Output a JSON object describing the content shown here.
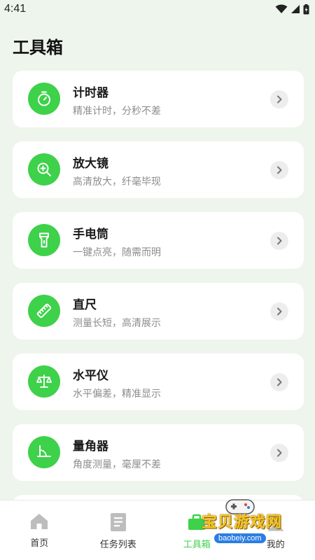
{
  "status_bar": {
    "time": "4:41",
    "icons": [
      "wifi-icon",
      "signal-icon",
      "battery-icon"
    ]
  },
  "page": {
    "title": "工具箱"
  },
  "tools": [
    {
      "name": "计时器",
      "desc": "精准计时，分秒不差",
      "icon": "stopwatch-icon"
    },
    {
      "name": "放大镜",
      "desc": "高清放大，纤毫毕现",
      "icon": "magnifier-icon"
    },
    {
      "name": "手电筒",
      "desc": "一键点亮，随需而明",
      "icon": "flashlight-icon"
    },
    {
      "name": "直尺",
      "desc": "测量长短，高清展示",
      "icon": "ruler-icon"
    },
    {
      "name": "水平仪",
      "desc": "水平偏差，精准显示",
      "icon": "scale-icon"
    },
    {
      "name": "量角器",
      "desc": "角度测量，毫厘不差",
      "icon": "protractor-icon"
    }
  ],
  "nav": {
    "items": [
      {
        "label": "首页",
        "icon": "home-icon"
      },
      {
        "label": "任务列表",
        "icon": "list-icon"
      },
      {
        "label": "工具箱",
        "icon": "toolbox-icon",
        "active": true
      },
      {
        "label": "我的",
        "icon": "profile-icon"
      }
    ],
    "active_color": "#3ed14a"
  },
  "watermark": {
    "text": "宝贝游戏网",
    "url": "baobeiy.com"
  },
  "colors": {
    "accent": "#3ed14a",
    "background": "#eef5ec",
    "card": "#ffffff"
  }
}
